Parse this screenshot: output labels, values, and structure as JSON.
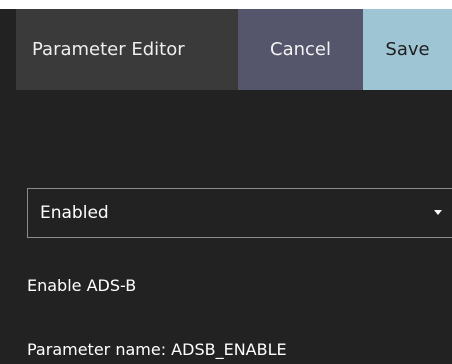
{
  "header": {
    "title": "Parameter Editor",
    "cancel_label": "Cancel",
    "save_label": "Save"
  },
  "parameter": {
    "selected_value": "Enabled",
    "description": "Enable ADS-B",
    "name_text": "Parameter name: ADSB_ENABLE"
  },
  "icons": {
    "dropdown": "chevron-down-icon"
  },
  "colors": {
    "background": "#222222",
    "header_bg": "#3a3a3a",
    "cancel_bg": "#55556b",
    "save_bg": "#9ec5d4"
  }
}
